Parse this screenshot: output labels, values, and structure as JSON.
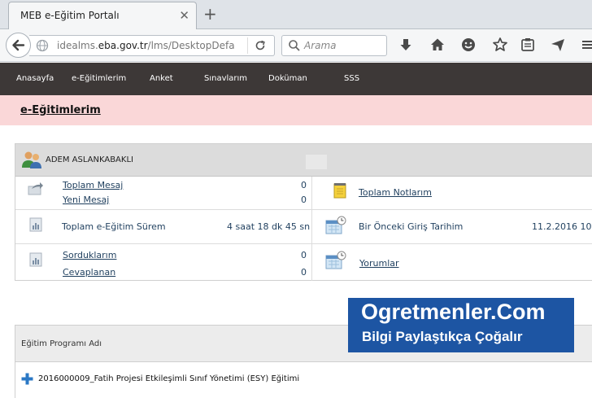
{
  "browser": {
    "tab_title": "MEB e-Eğitim Portalı",
    "url_domain": "idealms.",
    "url_host": "eba.gov.tr",
    "url_path": "/lms/DesktopDefa",
    "search_placeholder": "Arama"
  },
  "menu": [
    "Anasayfa",
    "e-Eğitimlerim",
    "Anket",
    "Sınavlarım",
    "Doküman",
    "SSS"
  ],
  "page_title": "e-Eğitimlerim",
  "user": {
    "name": "ADEM ASLANKABAKLI"
  },
  "stats": {
    "toplam_mesaj": {
      "label": "Toplam Mesaj",
      "value": "0"
    },
    "yeni_mesaj": {
      "label": "Yeni Mesaj",
      "value": "0"
    },
    "toplam_notlarim": {
      "label": "Toplam Notlarım"
    },
    "egitim_suresi": {
      "label": "Toplam e-Eğitim Sürem",
      "value": "4 saat 18 dk 45 sn"
    },
    "onceki_giris": {
      "label": "Bir Önceki Giriş Tarihim",
      "value": "11.2.2016 10"
    },
    "sorduklarim": {
      "label": "Sorduklarım",
      "value": "0"
    },
    "cevaplanan": {
      "label": "Cevaplanan",
      "value": "0"
    },
    "yorumlar": {
      "label": "Yorumlar"
    }
  },
  "watermark": {
    "line1": "Ogretmenler.Com",
    "line2": "Bilgi Paylaştıkça Çoğalır"
  },
  "program_table": {
    "header": "Eğitim Programı Adı",
    "rows": [
      "2016000009_Fatih Projesi Etkileşimli Sınıf Yönetimi (ESY) Eğitimi"
    ]
  },
  "colors": {
    "menu_bg": "#3d3837",
    "title_band": "#fad7d8",
    "link": "#1f3f5e",
    "watermark_bg": "#1d55a3"
  }
}
